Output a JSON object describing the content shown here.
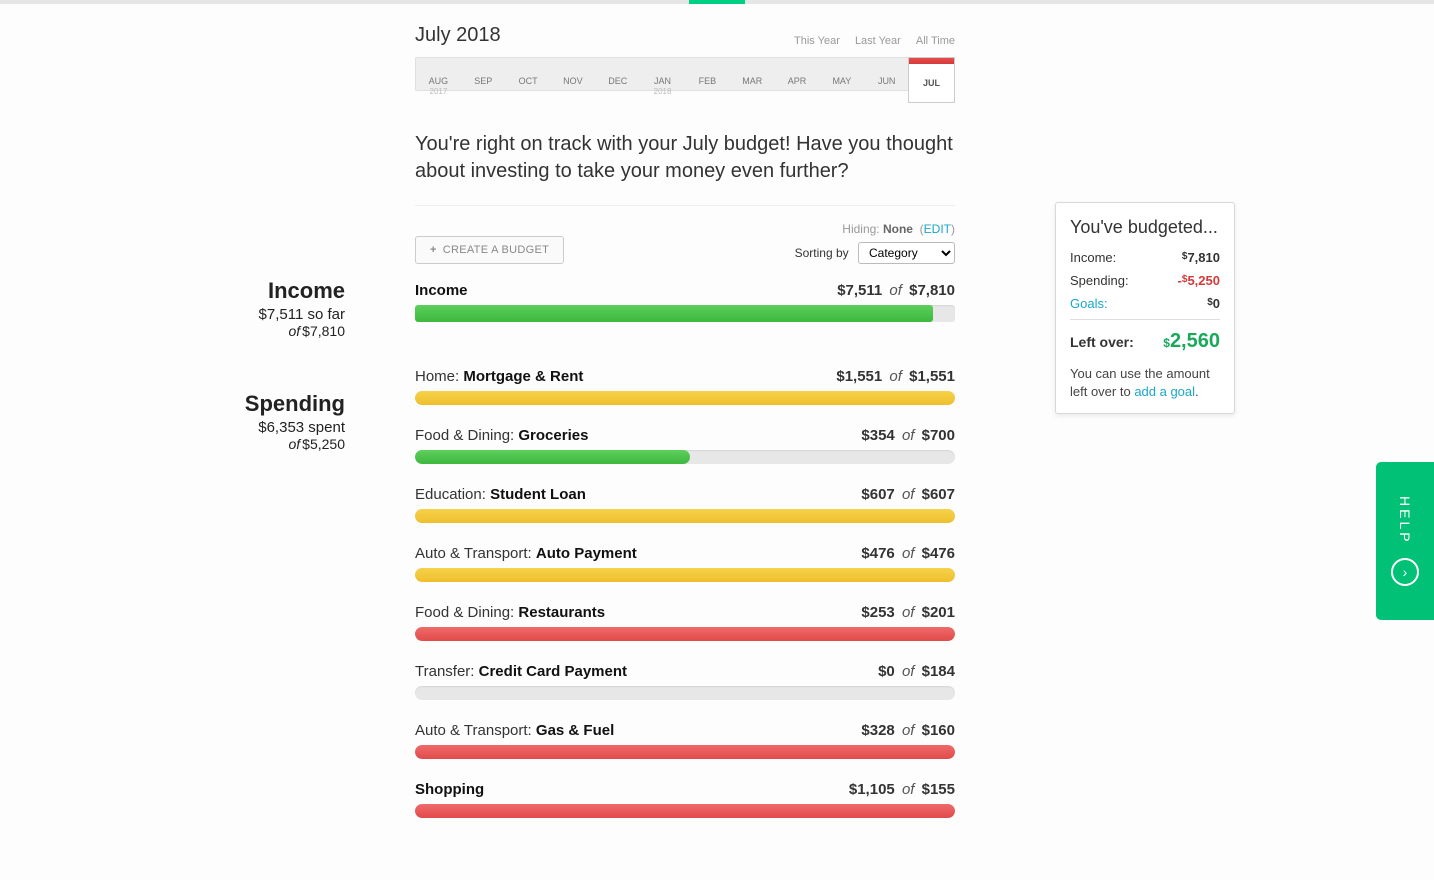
{
  "header": {
    "period_title": "July 2018",
    "range_links": [
      "This Year",
      "Last Year",
      "All Time"
    ],
    "months": [
      {
        "abbr": "AUG",
        "year": "2017"
      },
      {
        "abbr": "SEP"
      },
      {
        "abbr": "OCT"
      },
      {
        "abbr": "NOV"
      },
      {
        "abbr": "DEC"
      },
      {
        "abbr": "JAN",
        "year": "2018"
      },
      {
        "abbr": "FEB"
      },
      {
        "abbr": "MAR"
      },
      {
        "abbr": "APR"
      },
      {
        "abbr": "MAY"
      },
      {
        "abbr": "JUN"
      },
      {
        "abbr": "JUL",
        "selected": true
      }
    ],
    "insight": "You're right on track with your July budget! Have you thought about investing to take your money even further?"
  },
  "toolbar": {
    "create_label": "CREATE A BUDGET",
    "hiding_label": "Hiding:",
    "hiding_value": "None",
    "edit_label": "EDIT",
    "sort_label": "Sorting by",
    "sort_value": "Category"
  },
  "sidebar": {
    "income": {
      "title": "Income",
      "line1": "$7,511 so far",
      "of": "of",
      "total": "$7,810"
    },
    "spending": {
      "title": "Spending",
      "line1": "$6,353 spent",
      "of": "of",
      "total": "$5,250"
    }
  },
  "of_label": "of",
  "income_row": {
    "label": "Income",
    "spent": "$7,511",
    "total": "$7,810",
    "fill_pct": 96,
    "color": "green"
  },
  "budgets": [
    {
      "category": "Home:",
      "sub": "Mortgage & Rent",
      "spent": "$1,551",
      "total": "$1,551",
      "fill_pct": 100,
      "color": "yellow"
    },
    {
      "category": "Food & Dining:",
      "sub": "Groceries",
      "spent": "$354",
      "total": "$700",
      "fill_pct": 51,
      "color": "green"
    },
    {
      "category": "Education:",
      "sub": "Student Loan",
      "spent": "$607",
      "total": "$607",
      "fill_pct": 100,
      "color": "yellow"
    },
    {
      "category": "Auto & Transport:",
      "sub": "Auto Payment",
      "spent": "$476",
      "total": "$476",
      "fill_pct": 100,
      "color": "yellow"
    },
    {
      "category": "Food & Dining:",
      "sub": "Restaurants",
      "spent": "$253",
      "total": "$201",
      "fill_pct": 100,
      "color": "red"
    },
    {
      "category": "Transfer:",
      "sub": "Credit Card Payment",
      "spent": "$0",
      "total": "$184",
      "fill_pct": 0,
      "color": "grey"
    },
    {
      "category": "Auto & Transport:",
      "sub": "Gas & Fuel",
      "spent": "$328",
      "total": "$160",
      "fill_pct": 100,
      "color": "red"
    },
    {
      "category": "Shopping",
      "sub": "",
      "spent": "$1,105",
      "total": "$155",
      "fill_pct": 100,
      "color": "red"
    }
  ],
  "summary": {
    "title": "You've budgeted...",
    "income_label": "Income:",
    "income_val": "7,810",
    "spending_label": "Spending:",
    "spending_val": "5,250",
    "goals_label": "Goals:",
    "goals_val": "0",
    "leftover_label": "Left over:",
    "leftover_val": "2,560",
    "note_prefix": "You can use the amount left over to ",
    "note_link": "add a goal",
    "note_suffix": "."
  },
  "help": {
    "label": "HELP"
  }
}
